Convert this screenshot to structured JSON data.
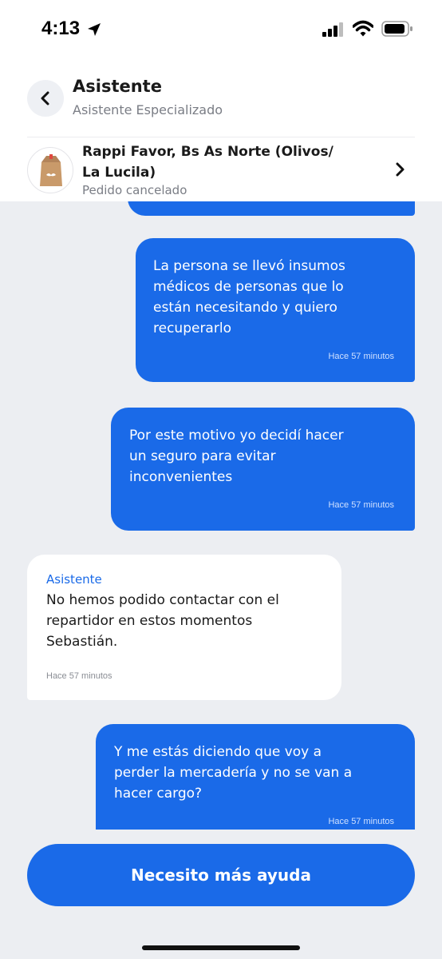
{
  "status_bar": {
    "time": "4:13",
    "icons": [
      "location-arrow-icon",
      "cellular-signal-icon",
      "wifi-icon",
      "battery-icon"
    ]
  },
  "header": {
    "back_icon": "chevron-left-icon",
    "title": "Asistente",
    "subtitle": "Asistente Especializado"
  },
  "order": {
    "avatar_icon": "paper-bag-icon",
    "title": "Rappi Favor, Bs As Norte (Olivos/ La Lucila)",
    "status": "Pedido cancelado",
    "chevron_icon": "chevron-right-icon"
  },
  "messages": [
    {
      "direction": "outgoing",
      "lines": [
        "La persona se llevó insumos",
        "médicos de personas que lo",
        "están necesitando y quiero",
        "recuperarlo"
      ],
      "time": "Hace 57 minutos"
    },
    {
      "direction": "outgoing",
      "lines": [
        "Por este motivo yo decidí hacer",
        "un seguro para evitar",
        "inconvenientes"
      ],
      "time": "Hace 57 minutos"
    },
    {
      "direction": "incoming",
      "sender": "Asistente",
      "lines": [
        "No hemos podido contactar con el",
        "repartidor en estos momentos",
        "Sebastián."
      ],
      "time": "Hace 57 minutos"
    },
    {
      "direction": "outgoing",
      "lines": [
        "Y me estás diciendo que voy a",
        "perder la mercadería y no se van a",
        "hacer cargo?"
      ],
      "time": "Hace 57 minutos"
    }
  ],
  "help_button": {
    "label": "Necesito más ayuda"
  },
  "colors": {
    "accent": "#1a6ae8",
    "chat_background": "#eceef2"
  }
}
